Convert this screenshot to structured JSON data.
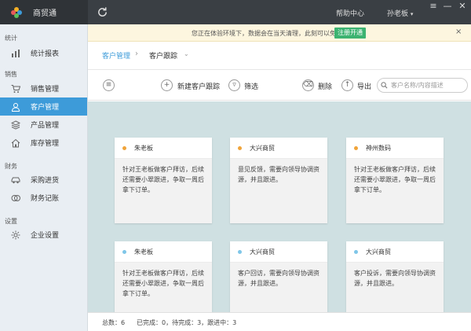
{
  "app": {
    "name": "商贸通"
  },
  "titlebar": {
    "help": "帮助中心",
    "user": "孙老板",
    "menu_glyph": "≡",
    "minimize_glyph": "—",
    "close_glyph": "✕"
  },
  "sidebar": {
    "sections": [
      {
        "title": "统计",
        "items": [
          {
            "label": "统计报表",
            "icon": "bar-chart-icon"
          }
        ]
      },
      {
        "title": "销售",
        "items": [
          {
            "label": "销售管理",
            "icon": "cart-icon"
          },
          {
            "label": "客户管理",
            "icon": "user-icon",
            "active": true
          },
          {
            "label": "产品管理",
            "icon": "layers-icon"
          },
          {
            "label": "库存管理",
            "icon": "house-icon"
          }
        ]
      },
      {
        "title": "财务",
        "items": [
          {
            "label": "采购进货",
            "icon": "car-icon"
          },
          {
            "label": "财务记账",
            "icon": "coins-icon"
          }
        ]
      },
      {
        "title": "设置",
        "items": [
          {
            "label": "企业设置",
            "icon": "gear-icon"
          }
        ]
      }
    ]
  },
  "notice": {
    "text": "您正在体验环境下，数据会在当天清理，此刻可以免费",
    "button": "注册开通",
    "close": "×"
  },
  "breadcrumb": {
    "parent": "客户管理",
    "separator": "›",
    "current": "客户跟踪",
    "caret": "⌄"
  },
  "toolbar": {
    "new": "新建客户跟踪",
    "filter": "筛选",
    "delete": "删除",
    "export": "导出",
    "search_placeholder": "客户名称/内容描述",
    "search_value": ""
  },
  "cards": [
    {
      "title": "朱老板",
      "body": "针对王老板做客户拜访，后续还需要小翠跟进，争取一周后拿下订单。",
      "dot": "#f0a43a"
    },
    {
      "title": "大兴商贸",
      "body": "意见反馈，需要向领导协调资源，并且跟进。",
      "dot": "#f0a43a"
    },
    {
      "title": "神州数码",
      "body": "针对王老板做客户拜访，后续还需要小翠跟进，争取一周后拿下订单。",
      "dot": "#f0a43a"
    },
    {
      "title": "朱老板",
      "body": "针对王老板做客户拜访，后续还需要小翠跟进，争取一周后拿下订单。",
      "dot": "#7fc6e8"
    },
    {
      "title": "大兴商贸",
      "body": "客户回访，需要向领导协调资源，并且跟进。",
      "dot": "#7fc6e8"
    },
    {
      "title": "大兴商贸",
      "body": "客户投诉，需要向领导协调资源，并且跟进。",
      "dot": "#7fc6e8"
    }
  ],
  "status": {
    "total": "总数：6",
    "done": "已完成：0，待完成：3，跟进中：3"
  },
  "colors": {
    "accent": "#3d9bd9",
    "notice_button": "#3cb371",
    "pending_dot": "#f0a43a",
    "progress_dot": "#7fc6e8"
  }
}
